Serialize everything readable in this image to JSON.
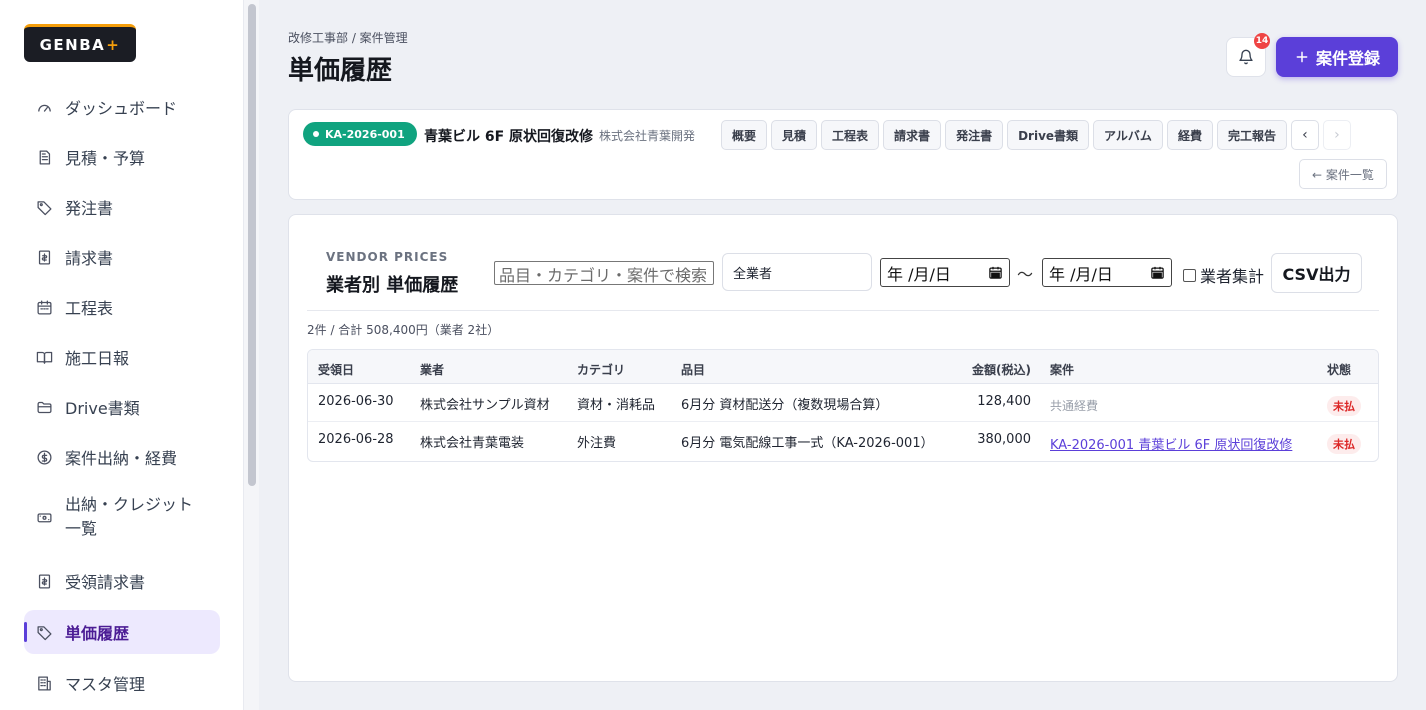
{
  "app": {
    "logo_text": "GENBA",
    "logo_plus": "+"
  },
  "sidebar": {
    "items": [
      {
        "label": "ダッシュボード",
        "icon": "gauge-icon",
        "active": false
      },
      {
        "label": "見積・予算",
        "icon": "document-list-icon",
        "active": false
      },
      {
        "label": "発注書",
        "icon": "tag-icon",
        "active": false
      },
      {
        "label": "請求書",
        "icon": "invoice-icon",
        "active": false
      },
      {
        "label": "工程表",
        "icon": "calendar-icon",
        "active": false
      },
      {
        "label": "施工日報",
        "icon": "book-icon",
        "active": false
      },
      {
        "label": "Drive書類",
        "icon": "folder-icon",
        "active": false
      },
      {
        "label": "案件出納・経費",
        "icon": "dollar-circle-icon",
        "active": false
      },
      {
        "label": "出納・クレジット一覧",
        "icon": "money-card-icon",
        "active": false
      },
      {
        "label": "受領請求書",
        "icon": "invoice-icon",
        "active": false
      },
      {
        "label": "単価履歴",
        "icon": "tag-icon",
        "active": true
      },
      {
        "label": "マスタ管理",
        "icon": "building-icon",
        "active": false
      }
    ]
  },
  "header": {
    "breadcrumb": "改修工事部 / 案件管理",
    "title": "単価履歴",
    "notification_count": "14",
    "new_project_label": "案件登録"
  },
  "project": {
    "code": "KA-2026-001",
    "name": "青葉ビル 6F 原状回復改修",
    "client": "株式会社青葉開発",
    "tabs": [
      "概要",
      "見積",
      "工程表",
      "請求書",
      "発注書",
      "Drive書類",
      "アルバム",
      "経費",
      "完工報告"
    ],
    "back_label": "← 案件一覧"
  },
  "vendor_prices": {
    "eyebrow": "VENDOR PRICES",
    "title": "業者別 単価履歴",
    "search_placeholder": "品目・カテゴリ・案件で検索",
    "vendor_select": "全業者",
    "date_placeholder": "年 /月/日",
    "range_sep": "〜",
    "aggregate_label": "業者集計",
    "csv_label": "CSV出力",
    "summary": "2件 / 合計 508,400円（業者 2社）",
    "columns": [
      "受領日",
      "業者",
      "カテゴリ",
      "品目",
      "金額(税込)",
      "案件",
      "状態"
    ],
    "rows": [
      {
        "date": "2026-06-30",
        "vendor": "株式会社サンプル資材",
        "category": "資材・消耗品",
        "item": "6月分 資材配送分（複数現場合算）",
        "amount": "128,400",
        "project": "共通経費",
        "project_link": false,
        "status": "未払"
      },
      {
        "date": "2026-06-28",
        "vendor": "株式会社青葉電装",
        "category": "外注費",
        "item": "6月分 電気配線工事一式（KA-2026-001）",
        "amount": "380,000",
        "project": "KA-2026-001 青葉ビル 6F 原状回復改修",
        "project_link": true,
        "status": "未払"
      }
    ]
  },
  "colors": {
    "accent": "#5b3fd9",
    "success": "#10a37f",
    "danger": "#dc2626",
    "logo_bg": "#1b1d24",
    "logo_accent": "#f59e0b"
  }
}
